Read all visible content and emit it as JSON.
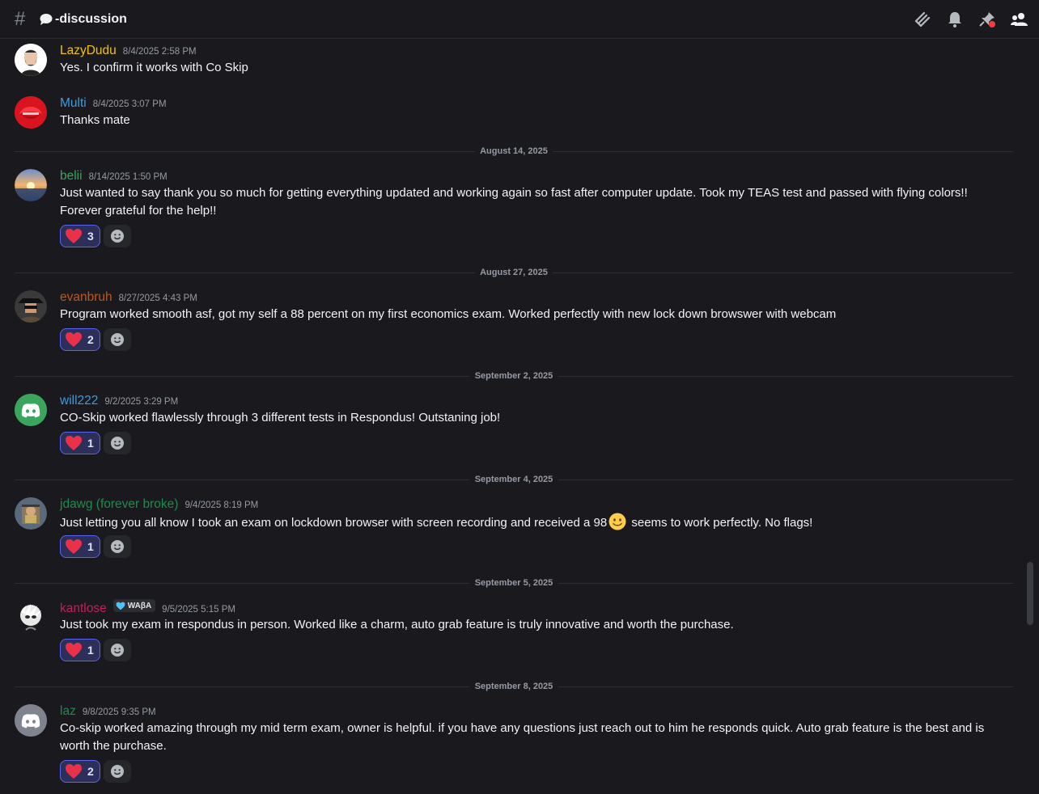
{
  "header": {
    "channel_name": "-discussion",
    "icons": [
      "hash-icon",
      "speech-bubble-icon",
      "threads-icon",
      "bell-icon",
      "pin-icon",
      "members-icon"
    ]
  },
  "messages": [
    {
      "username": "LazyDudu",
      "color": "#f0c400",
      "timestamp": "8/4/2025 2:58 PM",
      "text": "Yes. I confirm it works with Co Skip",
      "avatar": "avatar-lazydudu"
    },
    {
      "username": "Multi",
      "color": "#3e9ce0",
      "timestamp": "8/4/2025 3:07 PM",
      "text": "Thanks mate",
      "avatar": "avatar-multi"
    },
    {
      "username": "belii",
      "color": "#3ba55d",
      "timestamp": "8/14/2025 1:50 PM",
      "text_line1": "Just wanted to say thank you so much for getting everything updated and working again so fast after computer update. Took my TEAS test and passed with flying colors!!",
      "text_line2": "Forever grateful for the help!!",
      "reaction_count": "3",
      "avatar": "avatar-belii"
    },
    {
      "username": "evanbruh",
      "color": "#c0561c",
      "timestamp": "8/27/2025 4:43 PM",
      "text": "Program worked smooth asf,  got my self a 88 percent on my first economics exam. Worked perfectly with new lock down browswer with webcam",
      "reaction_count": "2",
      "avatar": "avatar-evanbruh"
    },
    {
      "username": "will222",
      "color": "#3e9ce0",
      "timestamp": "9/2/2025 3:29 PM",
      "text": "CO-Skip worked flawlessly through 3 different tests in Respondus! Outstaning job!",
      "reaction_count": "1",
      "avatar": "avatar-will222"
    },
    {
      "username": "jdawg (forever broke)",
      "color": "#1f8b4c",
      "timestamp": "9/4/2025 8:19 PM",
      "text_before": "Just letting you all know I took an exam on lockdown browser with screen recording and received a 98",
      "text_after": "seems to work perfectly. No flags!",
      "reaction_count": "1",
      "avatar": "avatar-jdawg"
    },
    {
      "username": "kantlose",
      "color": "#c41f5a",
      "badge": "WAβA",
      "timestamp": "9/5/2025 5:15 PM",
      "text": "Just took my exam in respondus in person. Worked like a charm, auto grab feature is truly innovative and worth the purchase.",
      "reaction_count": "1",
      "avatar": "avatar-kantlose"
    },
    {
      "username": "laz",
      "color": "#1f8b4c",
      "timestamp": "9/8/2025 9:35 PM",
      "text_line1": "Co-skip worked amazing through my mid term exam, owner is helpful. if you have any questions just reach out to him he responds quick. Auto grab feature is the best and is",
      "text_line2": "worth the purchase.",
      "reaction_count": "2",
      "avatar": "avatar-laz"
    }
  ],
  "dividers": [
    "August 14, 2025",
    "August 27, 2025",
    "September 2, 2025",
    "September 4, 2025",
    "September 5, 2025",
    "September 8, 2025"
  ]
}
